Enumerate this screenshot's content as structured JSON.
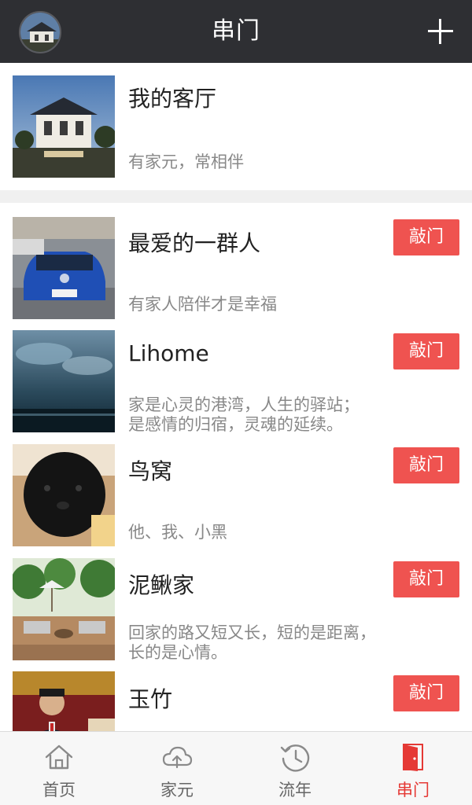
{
  "header": {
    "title": "串门"
  },
  "my_room": {
    "name": "我的客厅",
    "desc": "有家元，常相伴"
  },
  "items": [
    {
      "name": "最爱的一群人",
      "desc_line1": "有家人陪伴才是幸福",
      "desc_line2": "",
      "button": "敲门"
    },
    {
      "name": "Lihome",
      "desc_line1": "家是心灵的港湾，人生的驿站；",
      "desc_line2": "是感情的归宿，灵魂的延续。",
      "button": "敲门"
    },
    {
      "name": "鸟窝",
      "desc_line1": "他、我、小黑",
      "desc_line2": "",
      "button": "敲门"
    },
    {
      "name": "泥鳅家",
      "desc_line1": "回家的路又短又长，短的是距离，",
      "desc_line2": "长的是心情。",
      "button": "敲门"
    },
    {
      "name": "玉竹",
      "desc_line1": "",
      "desc_line2": "",
      "button": "敲门"
    }
  ],
  "tabs": [
    {
      "label": "首页",
      "icon": "home-icon"
    },
    {
      "label": "家元",
      "icon": "cloud-upload-icon"
    },
    {
      "label": "流年",
      "icon": "history-clock-icon"
    },
    {
      "label": "串门",
      "icon": "door-icon"
    }
  ],
  "colors": {
    "header_bg": "#2e2f33",
    "accent": "#ef5350",
    "tab_active": "#e53935"
  }
}
